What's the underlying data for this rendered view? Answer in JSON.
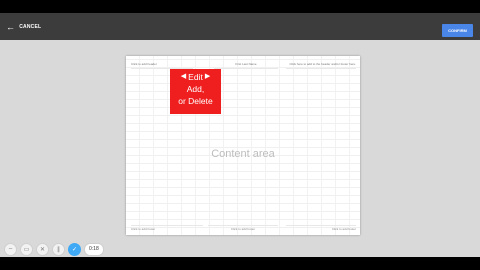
{
  "topbar": {
    "cancel_label": "CANCEL",
    "confirm_label": "CONFIRM"
  },
  "page": {
    "header_left": "Click to add header",
    "header_center": "First Last Name",
    "header_right": "Click here to add to the header and/or footer here.",
    "content_label": "Content area",
    "footer_left": "Click to add footer",
    "footer_center": "Click to add footer",
    "footer_right": "Click to add footer"
  },
  "callout": {
    "line1": "Edit",
    "line2": "Add,",
    "line3": "or Delete"
  },
  "recorder": {
    "timer": "0:18"
  },
  "colors": {
    "callout_bg": "#ef1f1f",
    "confirm_bg": "#4a86e8",
    "check_bg": "#3fa9f5"
  }
}
